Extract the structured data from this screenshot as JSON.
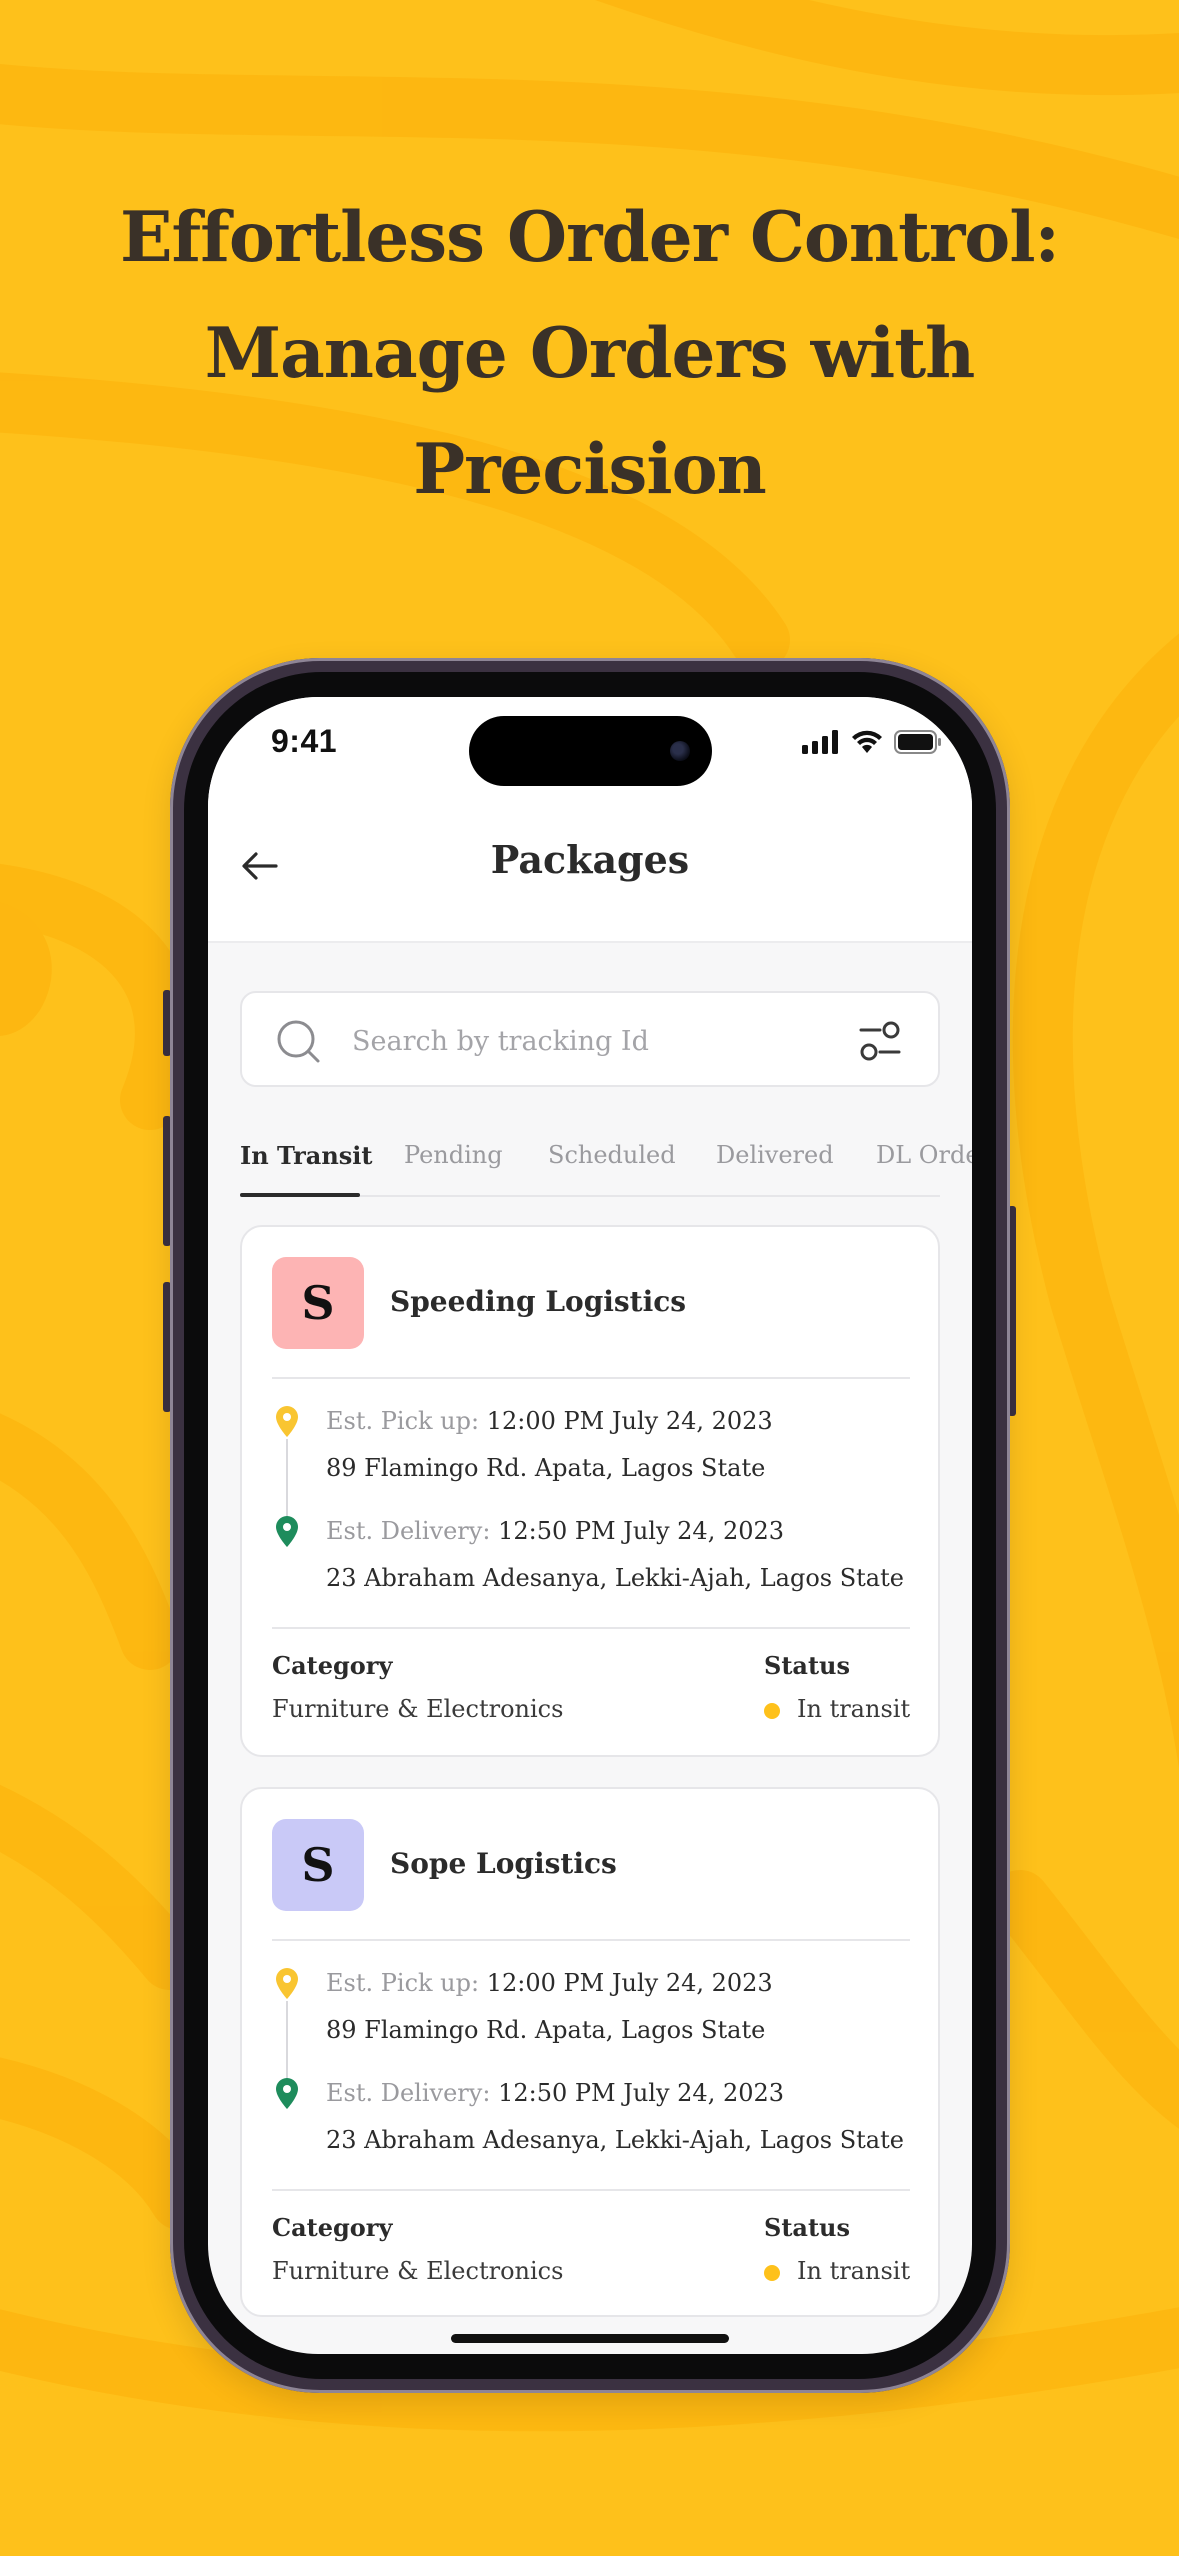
{
  "marketing": {
    "headline_lines": [
      "Effortless Order Control:",
      "Manage Orders with",
      "Precision"
    ]
  },
  "colors": {
    "background": "#FEC11B",
    "pickup_pin": "#F9C531",
    "delivery_pin": "#1E8C5C",
    "status_dot": "#FEC11B"
  },
  "status_bar": {
    "time": "9:41"
  },
  "header": {
    "title": "Packages",
    "back_icon": "arrow-left-icon"
  },
  "search": {
    "placeholder": "Search by tracking Id",
    "value": ""
  },
  "tabs": [
    {
      "label": "In Transit",
      "active": true
    },
    {
      "label": "Pending",
      "active": false
    },
    {
      "label": "Scheduled",
      "active": false
    },
    {
      "label": "Delivered",
      "active": false
    },
    {
      "label": "DL Orders",
      "active": false
    }
  ],
  "packages": [
    {
      "initial": "S",
      "avatar_color": "#FDB4B4",
      "company": "Speeding Logistics",
      "pickup": {
        "label": "Est. Pick up:",
        "time": "12:00 PM  July 24, 2023",
        "address": "89 Flamingo Rd. Apata, Lagos State"
      },
      "delivery": {
        "label": "Est. Delivery:",
        "time": "12:50 PM  July 24, 2023",
        "address": "23 Abraham Adesanya, Lekki-Ajah, Lagos State"
      },
      "category_label": "Category",
      "category": "Furniture & Electronics",
      "status_label": "Status",
      "status": "In transit"
    },
    {
      "initial": "S",
      "avatar_color": "#C9C9F7",
      "company": "Sope Logistics",
      "pickup": {
        "label": "Est. Pick up:",
        "time": "12:00 PM  July 24, 2023",
        "address": "89 Flamingo Rd. Apata, Lagos State"
      },
      "delivery": {
        "label": "Est. Delivery:",
        "time": "12:50 PM  July 24, 2023",
        "address": "23 Abraham Adesanya, Lekki-Ajah, Lagos State"
      },
      "category_label": "Category",
      "category": "Furniture & Electronics",
      "status_label": "Status",
      "status": "In transit"
    }
  ]
}
